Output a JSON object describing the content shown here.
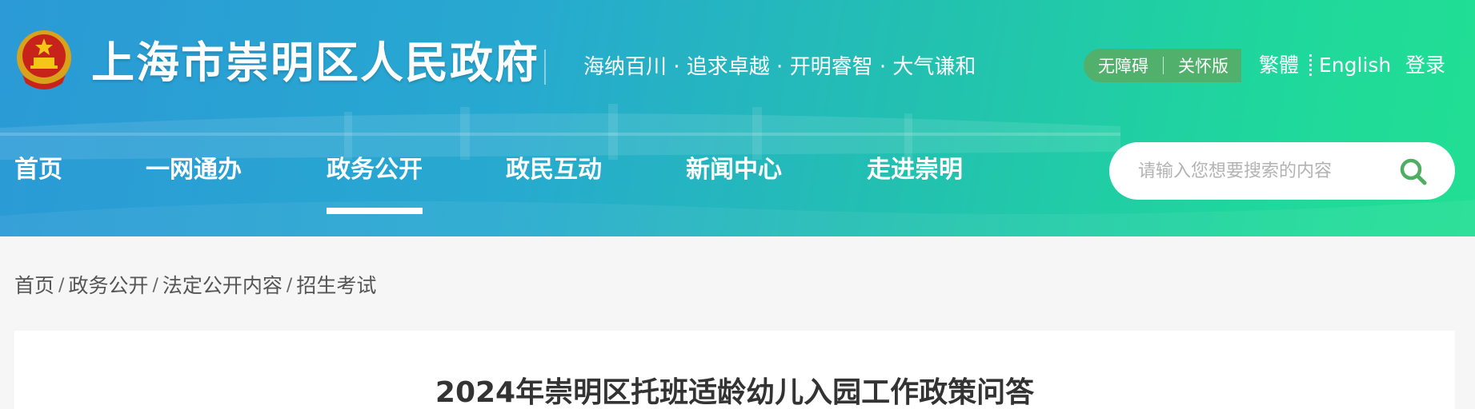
{
  "header": {
    "site_title": "上海市崇明区人民政府",
    "slogan": "海纳百川 · 追求卓越 · 开明睿智 · 大气谦和",
    "accessibility_label": "无障碍",
    "care_mode_label": "关怀版",
    "traditional_label": "繁體",
    "english_label": "English",
    "login_label": "登录",
    "emblem_icon": "national-emblem-icon"
  },
  "nav": {
    "items": [
      {
        "label": "首页"
      },
      {
        "label": "一网通办"
      },
      {
        "label": "政务公开",
        "active": true
      },
      {
        "label": "政民互动"
      },
      {
        "label": "新闻中心"
      },
      {
        "label": "走进崇明"
      }
    ]
  },
  "search": {
    "placeholder": "请输入您想要搜索的内容",
    "value": "",
    "icon": "search-icon"
  },
  "breadcrumb": {
    "items": [
      "首页",
      "政务公开",
      "法定公开内容",
      "招生考试"
    ],
    "separator": "/"
  },
  "article": {
    "title": "2024年崇明区托班适龄幼儿入园工作政策问答"
  },
  "colors": {
    "header_gradient_start": "#2b9ad6",
    "header_gradient_end": "#21df93",
    "accessibility_pill": "#52b06d",
    "search_icon": "#4fae61",
    "page_background": "#f6f6f6"
  }
}
